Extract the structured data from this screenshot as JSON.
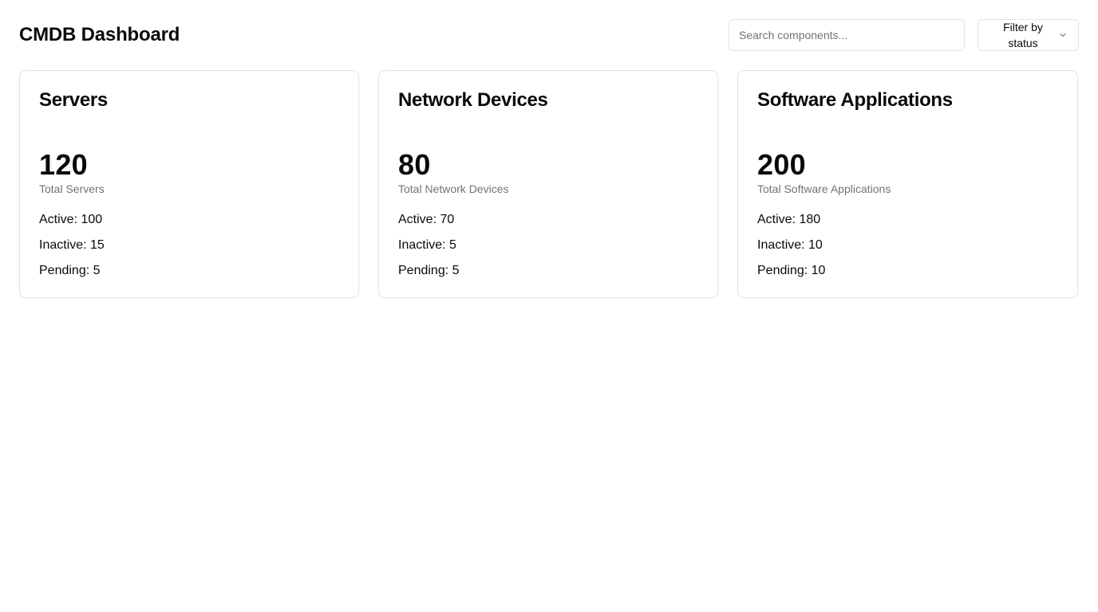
{
  "header": {
    "title": "CMDB Dashboard",
    "search_placeholder": "Search components...",
    "search_value": "",
    "filter_label": "Filter by status"
  },
  "cards": [
    {
      "title": "Servers",
      "total": "120",
      "total_label": "Total Servers",
      "active": "Active: 100",
      "inactive": "Inactive: 15",
      "pending": "Pending: 5"
    },
    {
      "title": "Network Devices",
      "total": "80",
      "total_label": "Total Network Devices",
      "active": "Active: 70",
      "inactive": "Inactive: 5",
      "pending": "Pending: 5"
    },
    {
      "title": "Software Applications",
      "total": "200",
      "total_label": "Total Software Applications",
      "active": "Active: 180",
      "inactive": "Inactive: 10",
      "pending": "Pending: 10"
    }
  ],
  "icons": {
    "filter_chevron": "chevron-down-icon"
  },
  "colors": {
    "text": "#0a0a0a",
    "muted": "#71717a",
    "border": "#e4e4e7",
    "background": "#ffffff"
  }
}
